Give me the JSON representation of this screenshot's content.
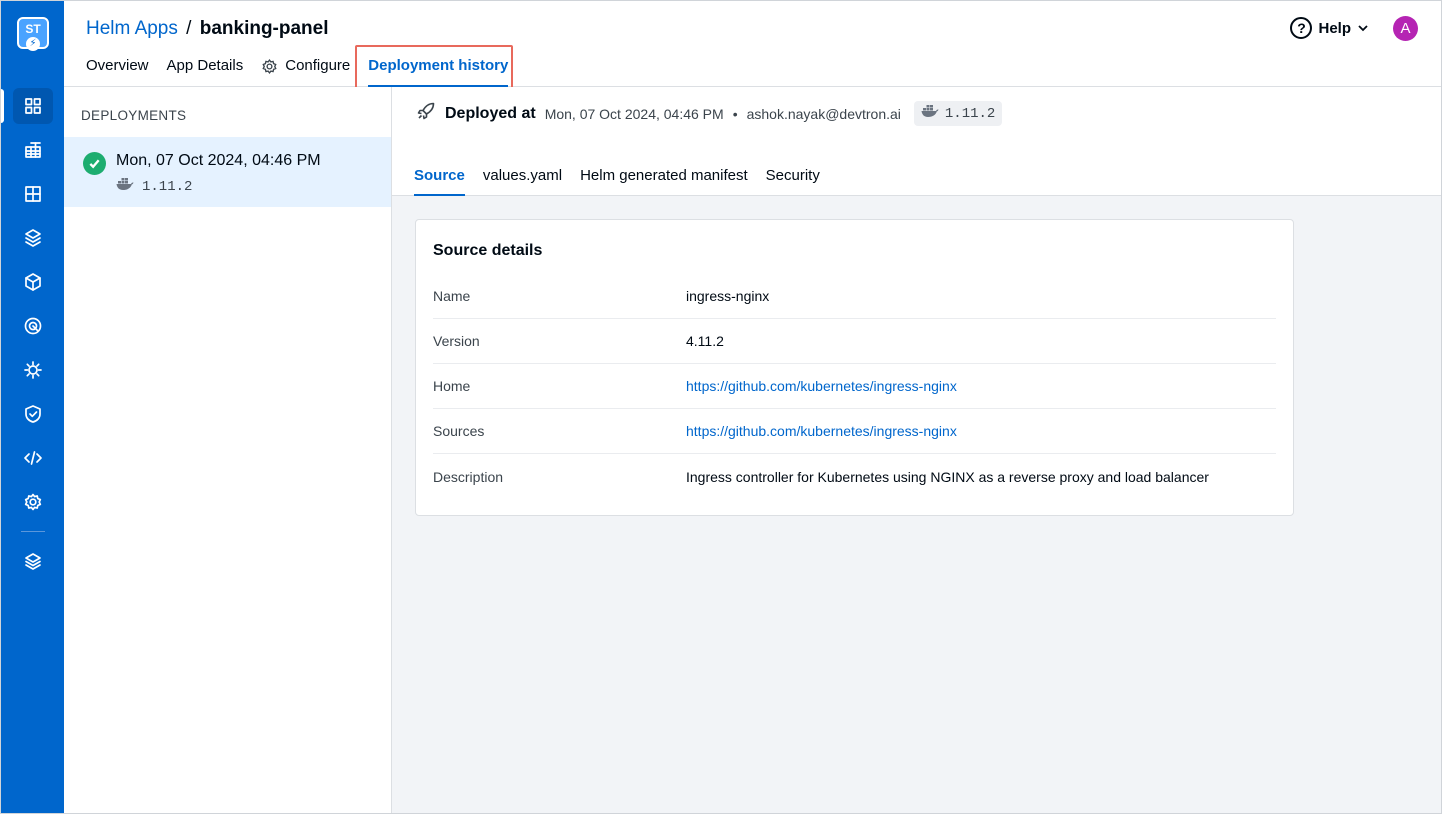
{
  "logo": {
    "text": "ST"
  },
  "header": {
    "breadcrumb": {
      "parent": "Helm Apps",
      "separator": "/",
      "current": "banking-panel"
    },
    "tabs": [
      {
        "label": "Overview"
      },
      {
        "label": "App Details"
      },
      {
        "label": "Configure"
      },
      {
        "label": "Deployment history"
      }
    ],
    "help_label": "Help",
    "avatar_initial": "A"
  },
  "deployments": {
    "title": "DEPLOYMENTS",
    "items": [
      {
        "date": "Mon, 07 Oct 2024, 04:46 PM",
        "version": "1.11.2",
        "status": "success"
      }
    ]
  },
  "detail": {
    "deployed_label": "Deployed at",
    "deployed_time": "Mon, 07 Oct 2024, 04:46 PM",
    "bullet": "•",
    "deployed_by": "ashok.nayak@devtron.ai",
    "image_tag": "1.11.2",
    "tabs": [
      {
        "label": "Source"
      },
      {
        "label": "values.yaml"
      },
      {
        "label": "Helm generated manifest"
      },
      {
        "label": "Security"
      }
    ],
    "source": {
      "title": "Source details",
      "rows": [
        {
          "key": "Name",
          "value": "ingress-nginx"
        },
        {
          "key": "Version",
          "value": "4.11.2"
        },
        {
          "key": "Home",
          "value": "https://github.com/kubernetes/ingress-nginx"
        },
        {
          "key": "Sources",
          "value": "https://github.com/kubernetes/ingress-nginx"
        },
        {
          "key": "Description",
          "value": "Ingress controller for Kubernetes using NGINX as a reverse proxy and load balancer"
        }
      ]
    }
  },
  "colors": {
    "accent": "#0066cc",
    "nav": "#0066cc",
    "success": "#1dad70",
    "highlight": "#e8695c"
  }
}
